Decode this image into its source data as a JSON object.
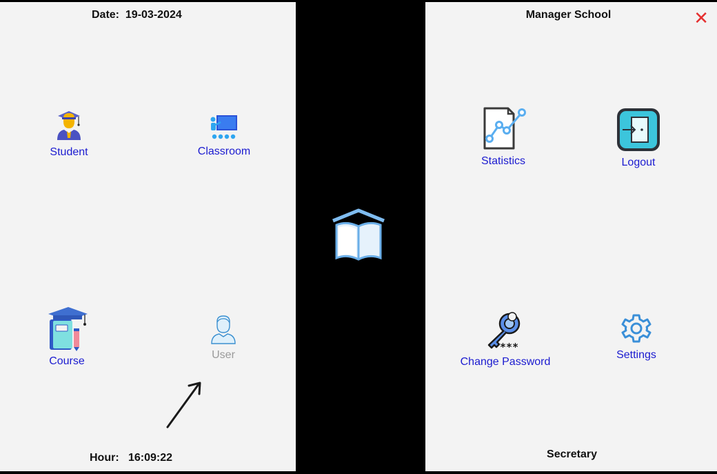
{
  "left": {
    "date_label": "Date:",
    "date_value": "19-03-2024",
    "hour_label": "Hour:",
    "hour_value": "16:09:22",
    "tiles": [
      {
        "label": "Student",
        "icon": "graduate-student-icon"
      },
      {
        "label": "Classroom",
        "icon": "classroom-board-icon"
      },
      {
        "label": "Course",
        "icon": "course-books-icon"
      },
      {
        "label": "User",
        "icon": "user-icon",
        "disabled": true
      }
    ]
  },
  "center": {
    "logo": "open-book-school-logo"
  },
  "right": {
    "title": "Manager School",
    "close": "✕",
    "tiles": [
      {
        "label": "Statistics",
        "icon": "statistics-chart-icon"
      },
      {
        "label": "Logout",
        "icon": "logout-door-icon"
      },
      {
        "label": "Change Password",
        "icon": "key-password-icon"
      },
      {
        "label": "Settings",
        "icon": "gear-icon"
      }
    ],
    "role": "Secretary"
  },
  "colors": {
    "label": "#1b1bd0",
    "disabled_label": "#9a9a9a",
    "close": "#e53030",
    "panel": "#f3f3f3"
  }
}
